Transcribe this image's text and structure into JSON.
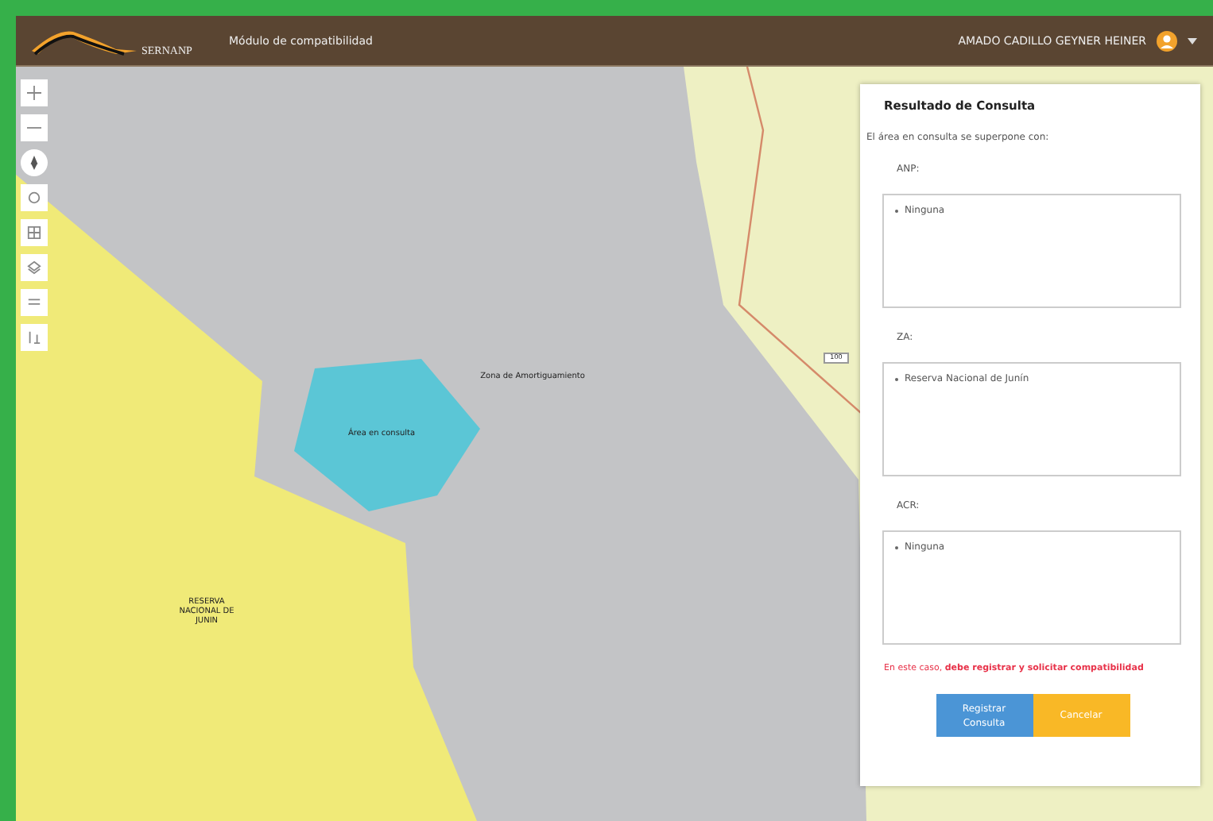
{
  "header": {
    "logo_text": "SERNANP",
    "title": "Módulo de compatibilidad",
    "user": "AMADO CADILLO GEYNER HEINER"
  },
  "map": {
    "labels": [
      {
        "kind": "zone",
        "text": "Zona de Amortiguamiento"
      },
      {
        "kind": "query",
        "text": "Área en consulta"
      },
      {
        "kind": "reserve",
        "text": "RESERVA NACIONAL DE JUNIN"
      },
      {
        "kind": "road",
        "text": "100"
      }
    ]
  },
  "panel": {
    "title": "Resultado de Consulta",
    "intro": "El área en consulta se superpone con:",
    "sections": [
      {
        "label": "ANP:",
        "items": [
          "Ninguna"
        ]
      },
      {
        "label": "ZA:",
        "items": [
          "Reserva Nacional de Junín"
        ]
      },
      {
        "label": "ACR:",
        "items": [
          "Ninguna"
        ]
      }
    ],
    "note": "En este caso, **debe registrar y solicitar compatibilidad**",
    "buttons": [
      {
        "kind": "primary",
        "label": "Registrar Consulta"
      },
      {
        "kind": "warning",
        "label": "Cancelar"
      }
    ]
  }
}
